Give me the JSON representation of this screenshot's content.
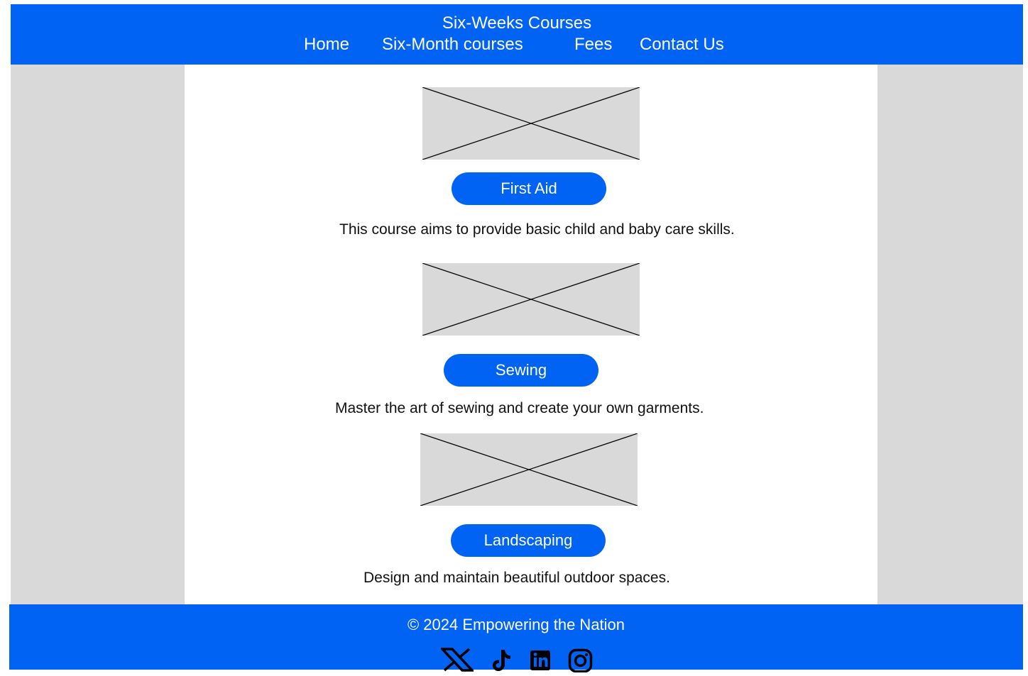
{
  "header": {
    "title": "Six-Weeks Courses",
    "nav": [
      {
        "label": "Home"
      },
      {
        "label": "Six-Month courses"
      },
      {
        "label": "Fees"
      },
      {
        "label": "Contact Us"
      }
    ]
  },
  "courses": [
    {
      "button_label": "First Aid",
      "description": "This course aims to provide basic child and baby care skills."
    },
    {
      "button_label": "Sewing",
      "description": "Master the art of sewing and create your own garments."
    },
    {
      "button_label": "Landscaping",
      "description": "Design and maintain beautiful outdoor spaces."
    }
  ],
  "footer": {
    "copyright": "© 2024 Empowering the Nation",
    "social_icons": [
      "x-icon",
      "tiktok-icon",
      "linkedin-icon",
      "instagram-icon"
    ]
  },
  "colors": {
    "brand_blue": "#0063f4",
    "sidebar_gray": "#d9d9d9",
    "placeholder_gray": "#d9d9d9"
  }
}
